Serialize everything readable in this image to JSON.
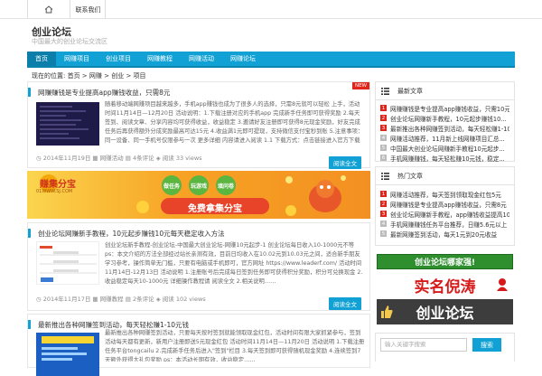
{
  "topbar": {
    "home_label": "",
    "link_label": "联系我们"
  },
  "site": {
    "title": "创业论坛",
    "subtitle": "中国最大的创业论坛交流区"
  },
  "nav": {
    "items": [
      "首页",
      "网赚项目",
      "创业项目",
      "网赚教程",
      "网赚活动",
      "网赚论坛"
    ]
  },
  "breadcrumb": "现在的位置: 首页 > 网赚 > 创业 > 项目",
  "posts": [
    {
      "title": "网赚赚钱是专业提高app赚钱收益，只需8元",
      "badge": "NEW",
      "excerpt": "随着移动端网赚项目越来越多，手机app赚钱也成为了很多人的选择，只需8元就可以轻松 上手，活动时间11月14日—12月20日 活动说明：1.下载注册对应的手机app 完成新手任务即可获得奖励 2.每天签到、阅读文章、分享内容均可获得收益，收益稳定 3.邀请好友注册即可获得8元现金奖励，好友完成任务后再获得额外分成奖励最高可达15元 4.收益满1元即可提现，支持微信支付宝秒到账 5.注意事项：同一设备、同一手机号仅限参与一次 更多详细 内容请进入阅读 1.1 下载方式：点击链接进入官方下载页面选择对应的app版本安装注册即可 2.现在加入即可领取新人红包奖励 1---3元不等……",
      "date": "2014年11月19日",
      "category": "网赚活动",
      "comments": "4条评论",
      "views": "阅读 33 views",
      "more": "阅读全文"
    },
    {
      "title": "创业论坛网赚新手教程，10元起步赚钱10元每天稳定收入方法",
      "excerpt": "创业论坛新手教程-创业论坛-中国最大创业论坛-网赚10元起步-1 创业论坛每日收入10-1000元不等 ps：本文介绍的方法全部经过站长亲测有效，目前日均收入在10.02元到10.03元之间，适合新手朋友学习参考，操作简单无门槛，只要有电脑或手机即可，官方网址 https://www.leaderf.com/ 活动时间 11月14日-12月13日 活动说明 1.注册账号后完成每日签到任务即可获得积分奖励，积分可兑换现金 2.收益稳定每天10-1000元 详细操作教程请 阅读全文 2.相关说明……",
      "date": "2014年11月17日",
      "category": "网赚教程",
      "comments": "2条评论",
      "views": "阅读 102 views",
      "more": "阅读全文"
    },
    {
      "title": "最新推出各种网赚签到活动，每天轻松赚1-10元钱",
      "excerpt": "最新推出各种网赚签到活动，只要每天按时签到就能领取现金红包，活动时间有限大家抓紧参与，签到活动每天都有更新，新用户注册即送5元现金红包 活动时间11月14日—11月20日 活动说明 1.下载注册任务平台tongcailu 2.完成新手任务后进入\"签到\"栏目 3.每天签到即可获得随机现金奖励 4.连续签到7天额外获得大礼包奖励 ps：本活动长期有效，收益稳定……",
      "date": "",
      "category": "",
      "comments": "",
      "views": "",
      "more": ""
    }
  ],
  "banner": {
    "brand": "赚集分宝",
    "brand_sub": "01WWW.SJ.COM",
    "tags": [
      "做任务",
      "玩游戏",
      "填问卷"
    ],
    "slogan": "免费拿集分宝"
  },
  "sidebar": {
    "latest": {
      "heading": "最新文章",
      "items": [
        "网赚赚钱是专业提高app赚钱收益，只需10元...",
        "创业论坛网赚新手教程，10元起步赚钱10...",
        "最新推出各种网赚签到活动，每天轻松赚1-10...",
        "网赚活动推荐，11月新上线网赚项目汇总...",
        "中国最大创业论坛网赚新手教程10元起步...",
        "手机网赚赚钱，每天轻松赚10元钱，稳定..."
      ]
    },
    "hot": {
      "heading": "热门文章",
      "items": [
        "网赚活动推荐，每天签到领取现金红包5元",
        "网赚赚钱是专业提高app赚钱收益，只需8元",
        "创业论坛网赚新手教程，app赚钱收益提高10元以上",
        "手机网赚赚钱任务平台推荐，日赚5.6元以上",
        "最新网赚签到活动，每天1元到20元收益"
      ]
    },
    "ad": {
      "line1": "创业论坛哪家强!",
      "line2": "实名倪涛",
      "line3": "创业论坛"
    },
    "search": {
      "placeholder": "输入关键字搜索",
      "button": "搜索"
    }
  },
  "colors": {
    "accent": "#11a1d4",
    "accent_dark": "#0b7fa9",
    "red": "#e0261c",
    "gray": "#bbbbbb"
  }
}
